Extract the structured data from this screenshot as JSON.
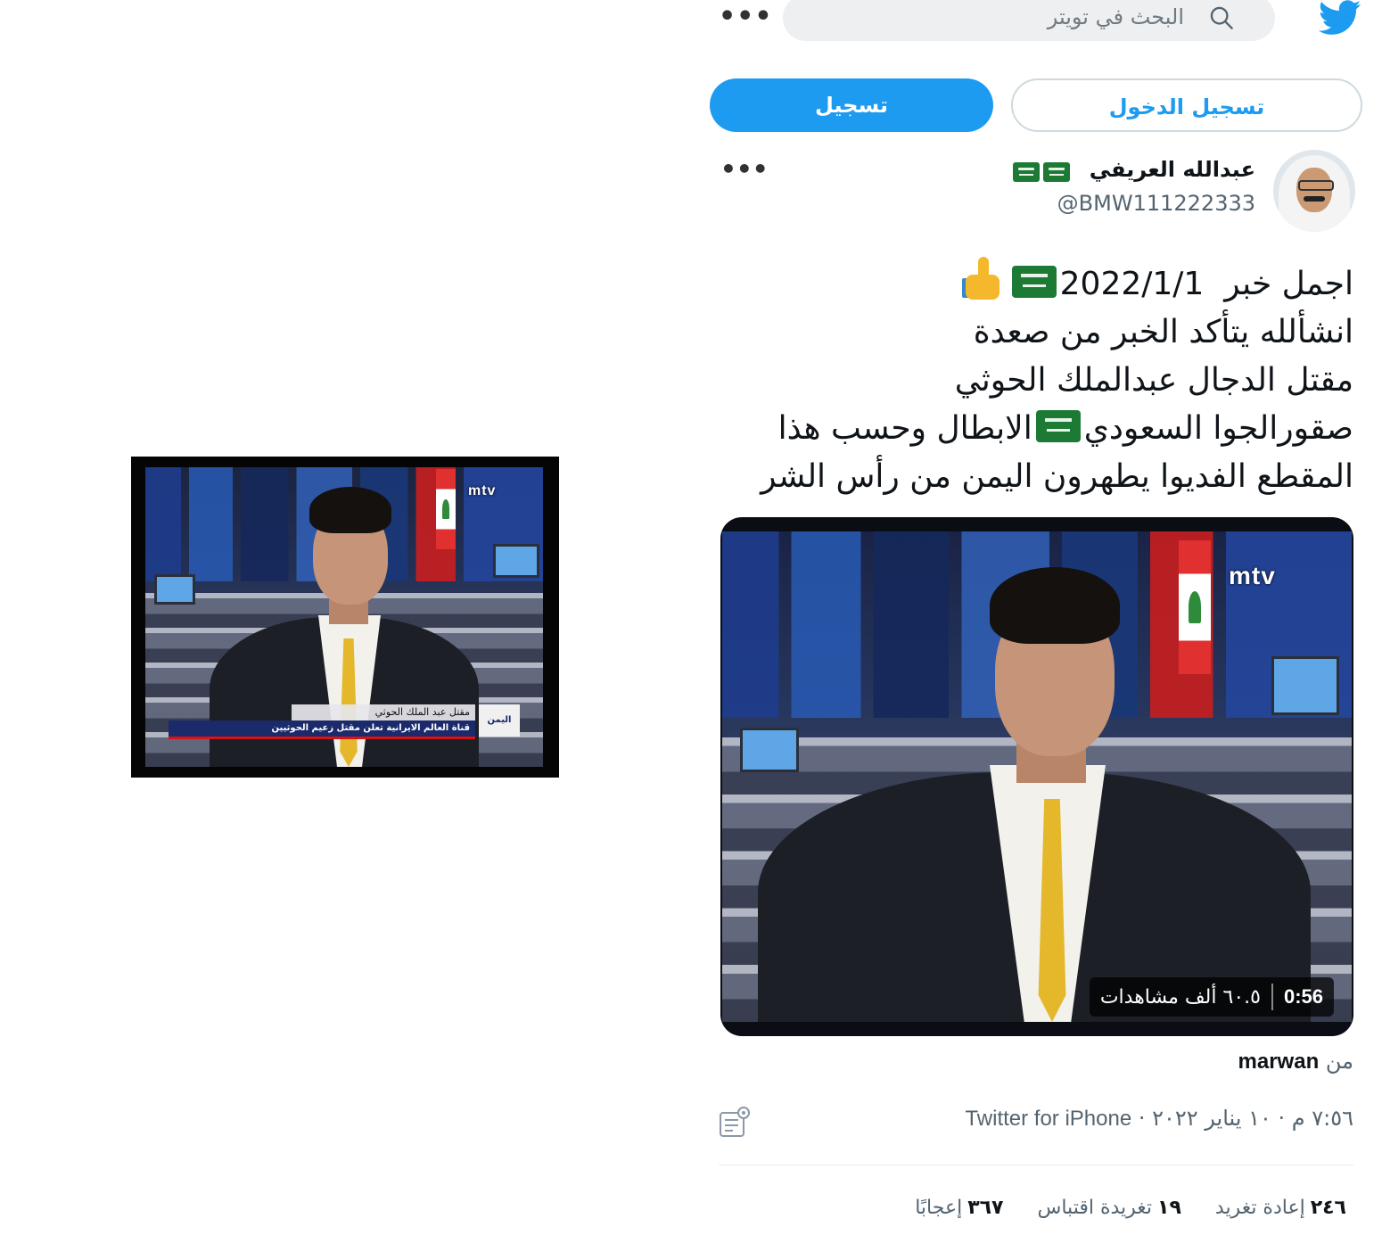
{
  "left_image": {
    "logo": "mtv",
    "lower_third_title": "مقتل عبد الملك الحوثي",
    "lower_third_sub": "قناة العالم الايرانية تعلن مقتل زعيم الحوثيين",
    "lower_third_tag": "اليمن"
  },
  "header": {
    "search_placeholder": "البحث في تويتر",
    "more": "•••"
  },
  "auth": {
    "login_label": "تسجيل الدخول",
    "signup_label": "تسجيل"
  },
  "author": {
    "display_name": "عبدالله العريفي",
    "handle": "@BMW111222333",
    "more": "•••"
  },
  "tweet": {
    "line1_a": "اجمل خبر",
    "line1_date": "2022/1/1",
    "line2": "انشألله يتأكد الخبر من صعدة",
    "line3": "مقتل الدجال عبدالملك الحوثي",
    "line4_a": "صقورالجوا السعودي",
    "line4_b": "الابطال وحسب هذا",
    "line5": "المقطع الفديوا يطهرون اليمن من رأس الشر"
  },
  "video": {
    "logo": "mtv",
    "duration": "0:56",
    "views": "٦٠.٥ ألف مشاهدات"
  },
  "source": {
    "prefix": "من",
    "user": "marwan"
  },
  "meta": {
    "time_date": "٧:٥٦ م · ١٠ يناير ٢٠٢٢ ·",
    "client": "Twitter for iPhone"
  },
  "stats": {
    "retweets_count": "٢٤٦",
    "retweets_label": "إعادة تغريد",
    "quotes_count": "١٩",
    "quotes_label": "تغريدة اقتباس",
    "likes_count": "٣٦٧",
    "likes_label": "إعجابًا"
  },
  "colors": {
    "twitter_blue": "#1d9bf0",
    "text_primary": "#0f1419",
    "text_secondary": "#536471",
    "saudi_green": "#1c7a35",
    "tie_gold": "#e4b82a"
  }
}
